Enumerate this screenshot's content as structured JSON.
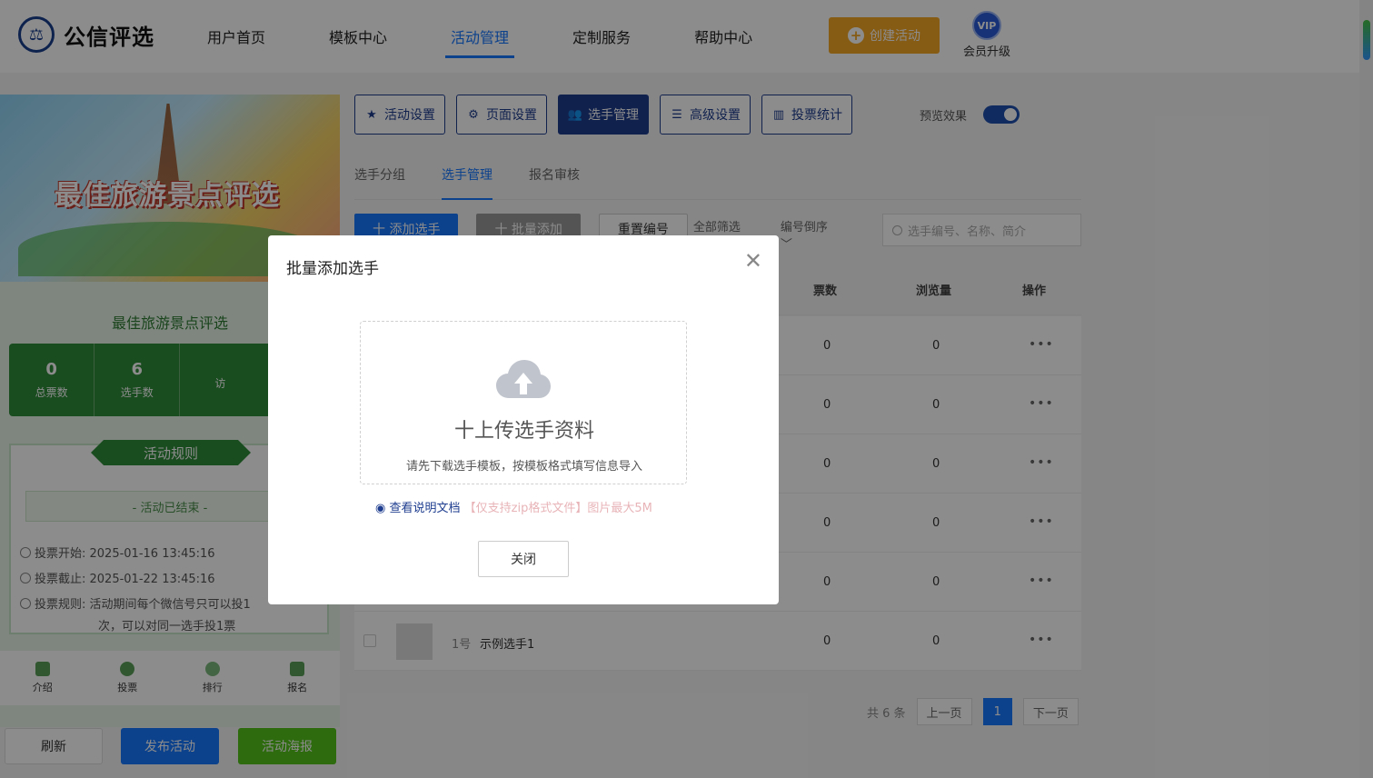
{
  "header": {
    "logo_text": "公信评选",
    "nav": [
      "用户首页",
      "模板中心",
      "活动管理",
      "定制服务",
      "帮助中心"
    ],
    "create_label": "创建活动",
    "vip_badge": "VIP",
    "vip_label": "会员升级"
  },
  "left": {
    "banner_title": "最佳旅游景点评选",
    "activity_name": "最佳旅游景点评选",
    "stats": [
      {
        "num": "0",
        "label": "总票数"
      },
      {
        "num": "6",
        "label": "选手数"
      },
      {
        "num": "",
        "label": "访"
      }
    ],
    "rules_title": "活动规则",
    "ended": "- 活动已结束 -",
    "vote_start": "投票开始:  2025-01-16 13:45:16",
    "vote_end": "投票截止:  2025-01-22 13:45:16",
    "vote_rule_1": "投票规则:  活动期间每个微信号只可以投1",
    "vote_rule_2": "次，可以对同一选手投1票",
    "tabbar": [
      "介绍",
      "投票",
      "排行",
      "报名"
    ],
    "buttons": {
      "refresh": "刷新",
      "publish": "发布活动",
      "poster": "活动海报"
    }
  },
  "toolbar": {
    "items": [
      "活动设置",
      "页面设置",
      "选手管理",
      "高级设置",
      "投票统计"
    ],
    "preview_label": "预览效果"
  },
  "subtabs": [
    "选手分组",
    "选手管理",
    "报名审核"
  ],
  "actions": {
    "add": "十 添加选手",
    "batch": "十 批量添加",
    "reset": "重置编号",
    "filter": "全部筛选",
    "order": "编号倒序",
    "search_placeholder": "选手编号、名称、简介"
  },
  "table": {
    "headers": {
      "votes": "票数",
      "views": "浏览量",
      "ops": "操作"
    },
    "rows": [
      {
        "votes": "0",
        "views": "0"
      },
      {
        "votes": "0",
        "views": "0"
      },
      {
        "votes": "0",
        "views": "0"
      },
      {
        "votes": "0",
        "views": "0"
      },
      {
        "votes": "0",
        "views": "0"
      },
      {
        "num": "1号",
        "name": "示例选手1",
        "votes": "0",
        "views": "0"
      }
    ],
    "ops_glyph": "•••"
  },
  "pager": {
    "total": "共 6 条",
    "prev": "上一页",
    "current": "1",
    "next": "下一页"
  },
  "modal": {
    "title": "批量添加选手",
    "upload_title": "十上传选手资料",
    "upload_hint": "请先下载选手模板，按模板格式填写信息导入",
    "doc_link": "查看说明文档",
    "doc_note": "【仅支持zip格式文件】图片最大5M",
    "close_label": "关闭"
  }
}
